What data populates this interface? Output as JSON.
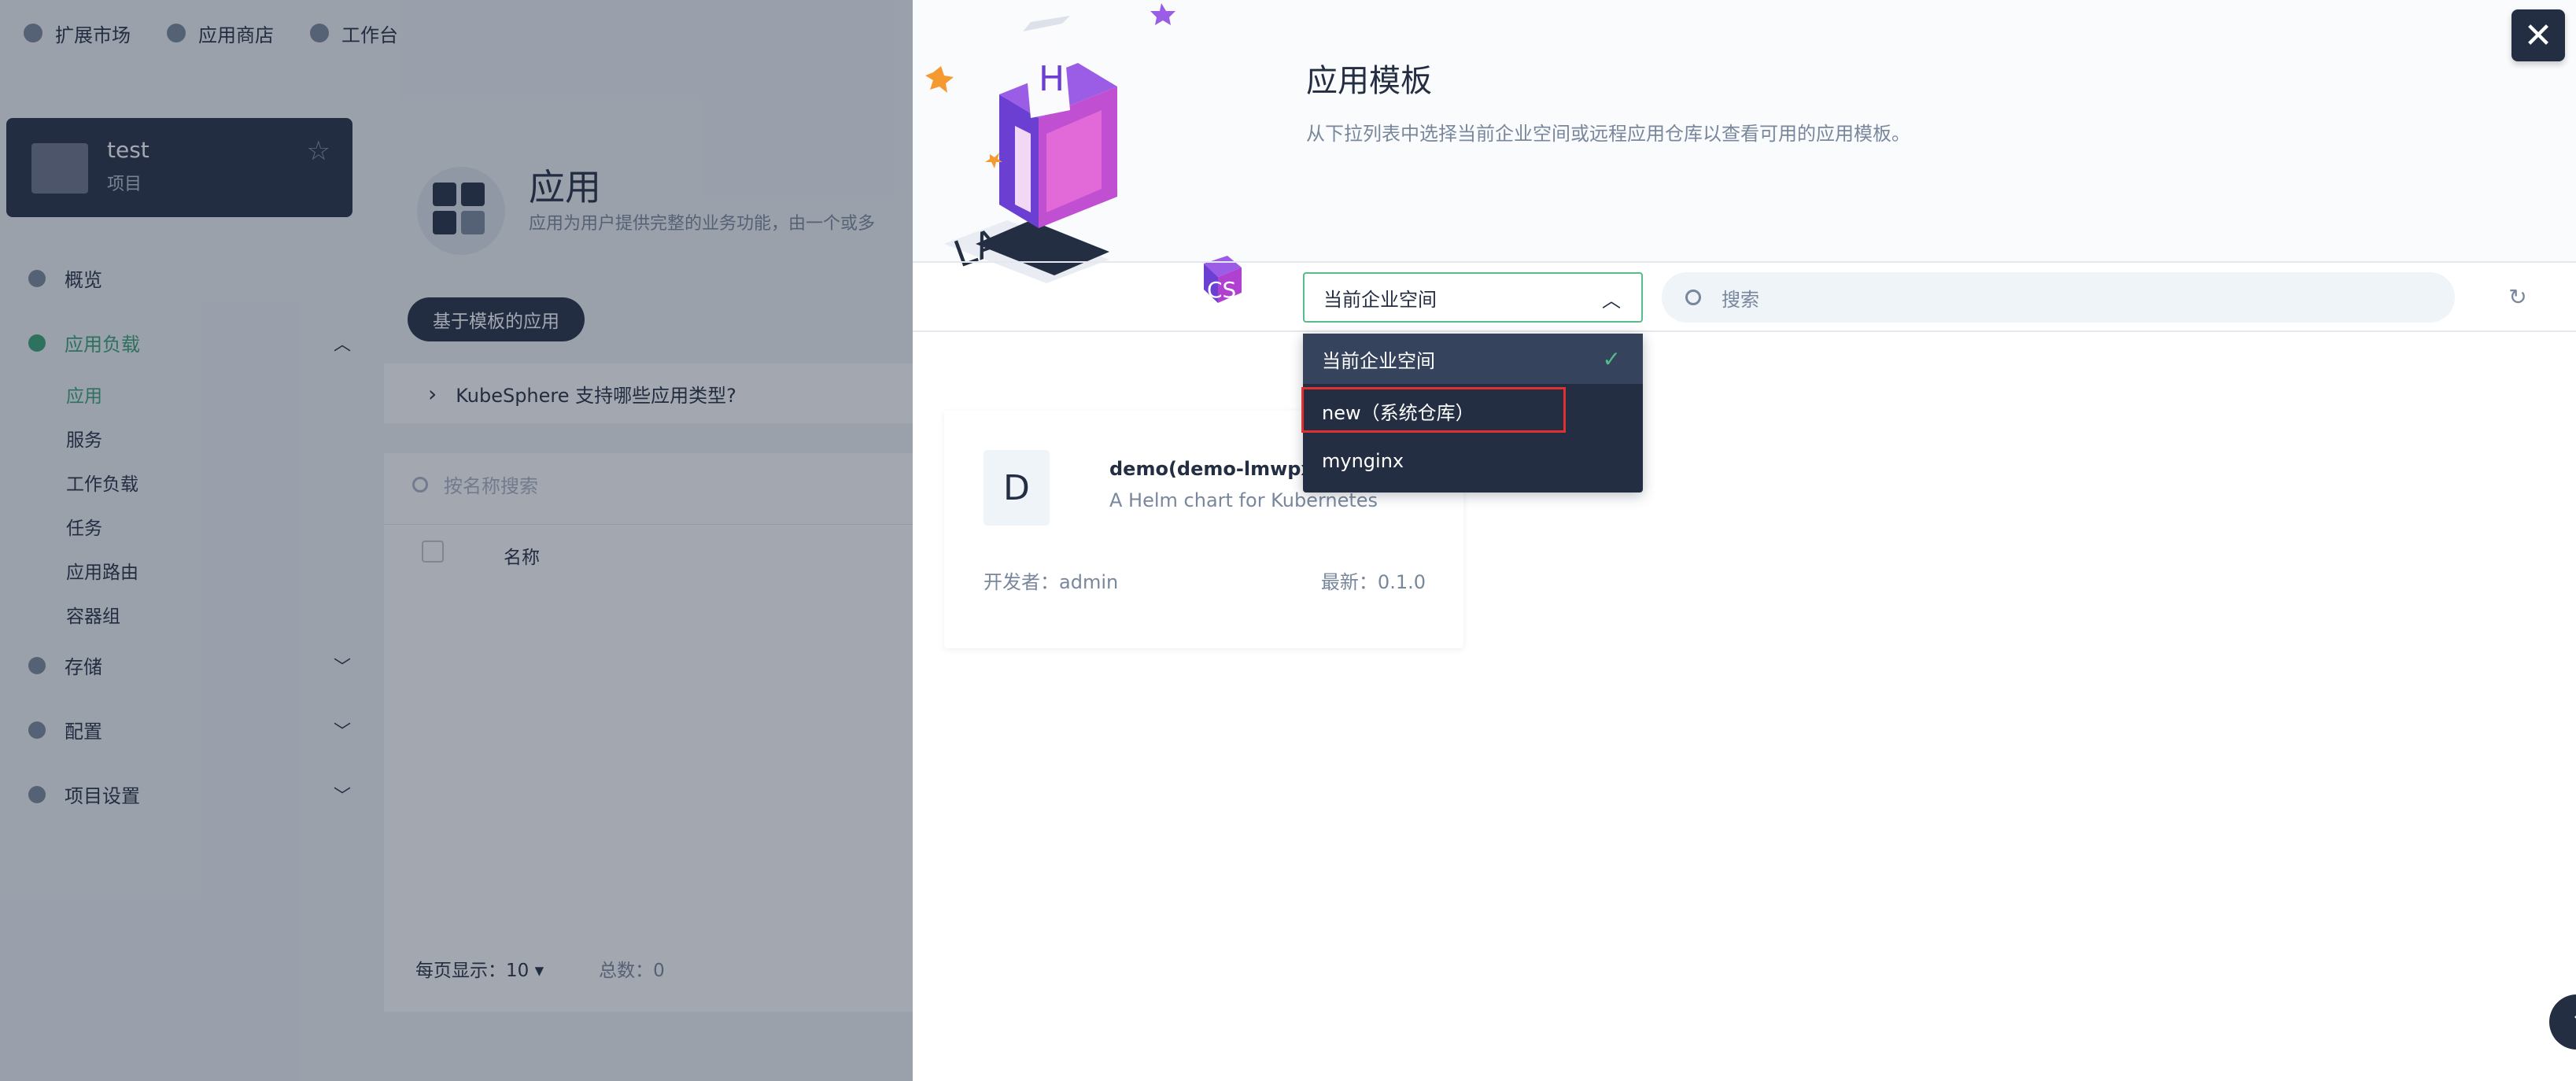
{
  "topbar": {
    "items": [
      {
        "label": "扩展市场",
        "icon": "extensions-icon"
      },
      {
        "label": "应用商店",
        "icon": "app-store-icon"
      },
      {
        "label": "工作台",
        "icon": "workbench-icon"
      }
    ]
  },
  "project": {
    "name": "test",
    "type": "项目"
  },
  "sidebar": {
    "overview": "概览",
    "workloads": {
      "label": "应用负载",
      "children": [
        "应用",
        "服务",
        "工作负载",
        "任务",
        "应用路由",
        "容器组"
      ]
    },
    "storage": "存储",
    "config": "配置",
    "project_settings": "项目设置"
  },
  "main": {
    "title": "应用",
    "description": "应用为用户提供完整的业务功能，由一个或多",
    "template_button": "基于模板的应用",
    "faq": "KubeSphere 支持哪些应用类型?",
    "search_placeholder": "按名称搜索",
    "column_name": "名称",
    "page_size": "每页显示：10",
    "total": "总数：0"
  },
  "drawer": {
    "title": "应用模板",
    "description": "从下拉列表中选择当前企业空间或远程应用仓库以查看可用的应用模板。",
    "repo_select": {
      "value": "当前企业空间",
      "options": [
        "当前企业空间",
        "new（系统仓库）",
        "mynginx"
      ],
      "selected_index": 0
    },
    "search_placeholder": "搜索",
    "apps": [
      {
        "avatar": "D",
        "name": "demo(demo-lmwpx)",
        "description": "A Helm chart for Kubernetes",
        "developer": "开发者：admin",
        "latest": "最新：0.1.0"
      }
    ]
  },
  "colors": {
    "accent": "#55bc8a",
    "dark": "#242e42",
    "highlight": "#e03131"
  }
}
